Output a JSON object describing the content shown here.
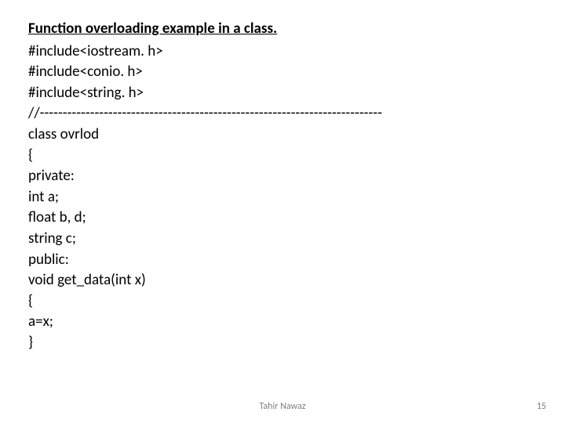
{
  "title": "Function overloading example in a class.",
  "lines": {
    "l0": "#include<iostream. h>",
    "l1": "#include<conio. h>",
    "l2": "#include<string. h>",
    "l3": "//---------------------------------------------------------------------------",
    "l4": "class ovrlod",
    "l5": "{",
    "l6": "private:",
    "l7": "int a;",
    "l8": "float b, d;",
    "l9": "string c;",
    "l10": "public:",
    "l11": "void get_data(int x)",
    "l12": "{",
    "l13": "a=x;",
    "l14": "}"
  },
  "footer": {
    "author": "Tahir Nawaz",
    "page": "15"
  }
}
